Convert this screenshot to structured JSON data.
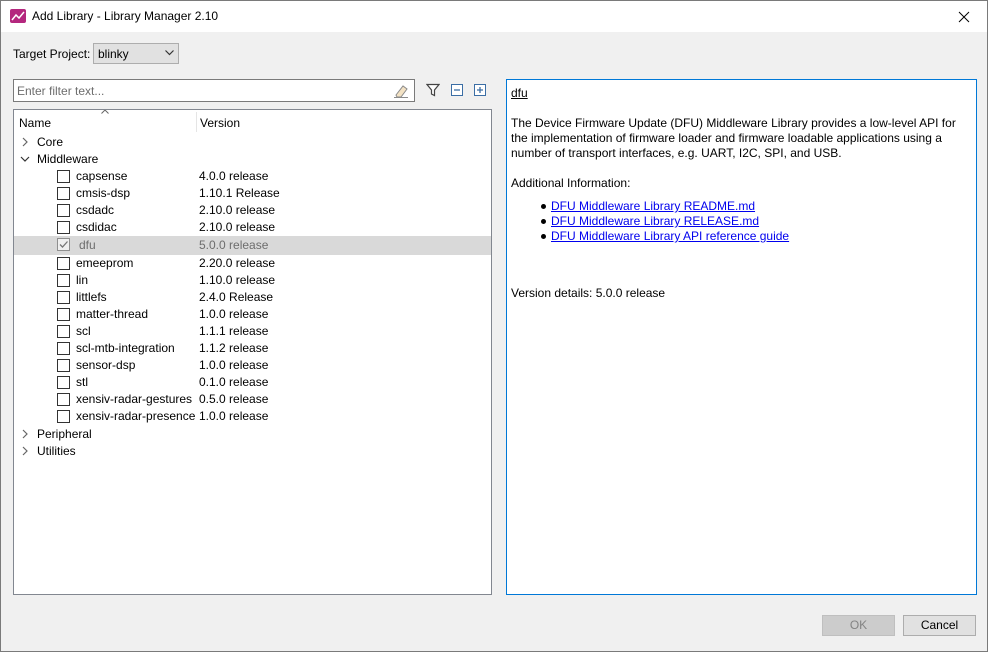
{
  "window": {
    "title": "Add Library - Library Manager 2.10"
  },
  "target": {
    "label": "Target Project:",
    "value": "blinky"
  },
  "filter": {
    "placeholder": "Enter filter text..."
  },
  "columns": {
    "name": "Name",
    "version": "Version"
  },
  "tree": {
    "core": "Core",
    "middleware": "Middleware",
    "items": [
      {
        "name": "capsense",
        "version": "4.0.0 release",
        "checked": false
      },
      {
        "name": "cmsis-dsp",
        "version": "1.10.1 Release",
        "checked": false
      },
      {
        "name": "csdadc",
        "version": "2.10.0 release",
        "checked": false
      },
      {
        "name": "csdidac",
        "version": "2.10.0 release",
        "checked": false
      },
      {
        "name": "dfu",
        "version": "5.0.0 release",
        "checked": true
      },
      {
        "name": "emeeprom",
        "version": "2.20.0 release",
        "checked": false
      },
      {
        "name": "lin",
        "version": "1.10.0 release",
        "checked": false
      },
      {
        "name": "littlefs",
        "version": "2.4.0 Release",
        "checked": false
      },
      {
        "name": "matter-thread",
        "version": "1.0.0 release",
        "checked": false
      },
      {
        "name": "scl",
        "version": "1.1.1 release",
        "checked": false
      },
      {
        "name": "scl-mtb-integration",
        "version": "1.1.2 release",
        "checked": false
      },
      {
        "name": "sensor-dsp",
        "version": "1.0.0 release",
        "checked": false
      },
      {
        "name": "stl",
        "version": "0.1.0 release",
        "checked": false
      },
      {
        "name": "xensiv-radar-gestures",
        "version": "0.5.0 release",
        "checked": false
      },
      {
        "name": "xensiv-radar-presence",
        "version": "1.0.0 release",
        "checked": false
      }
    ],
    "peripheral": "Peripheral",
    "utilities": "Utilities"
  },
  "description": {
    "title": "dfu",
    "text": "The Device Firmware Update (DFU) Middleware Library provides a low-level API for the implementation of firmware loader and firmware loadable applications using a number of transport interfaces, e.g. UART, I2C, SPI, and USB.",
    "additional_label": "Additional Information:",
    "links": [
      "DFU Middleware Library README.md",
      "DFU Middleware Library RELEASE.md",
      "DFU Middleware Library API reference guide"
    ],
    "version_details": "Version details: 5.0.0 release"
  },
  "buttons": {
    "ok": "OK",
    "cancel": "Cancel"
  },
  "colors": {
    "accent": "#0078d7",
    "link": "#0000ee",
    "selected_row": "#d9d9d9",
    "app_icon": "#b4277e"
  }
}
